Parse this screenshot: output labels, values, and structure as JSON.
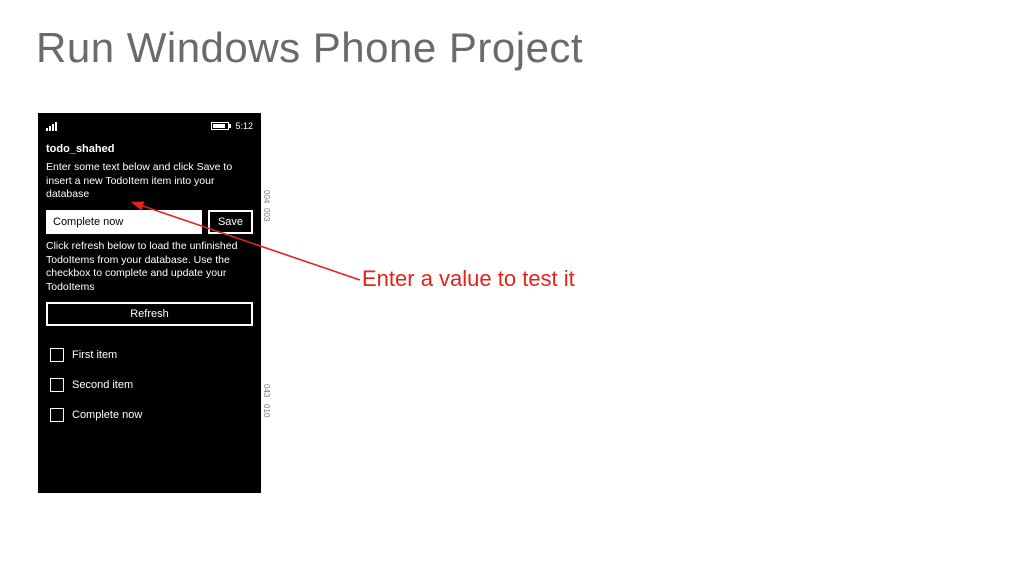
{
  "slide": {
    "title": "Run Windows Phone Project"
  },
  "phone": {
    "time": "5:12",
    "app_title": "todo_shahed",
    "instr_top": "Enter some text below and click Save to insert a new TodoItem item into your database",
    "input_value": "Complete now",
    "save_label": "Save",
    "instr_mid": "Click refresh below to load the unfinished TodoItems from your database. Use the checkbox to complete and update your TodoItems",
    "refresh_label": "Refresh",
    "items": [
      {
        "label": "First item"
      },
      {
        "label": "Second item"
      },
      {
        "label": "Complete now"
      }
    ]
  },
  "markers": {
    "a": "004",
    "b": "003",
    "c": "043",
    "d": "010"
  },
  "annotation": {
    "text": "Enter a value to test it"
  }
}
